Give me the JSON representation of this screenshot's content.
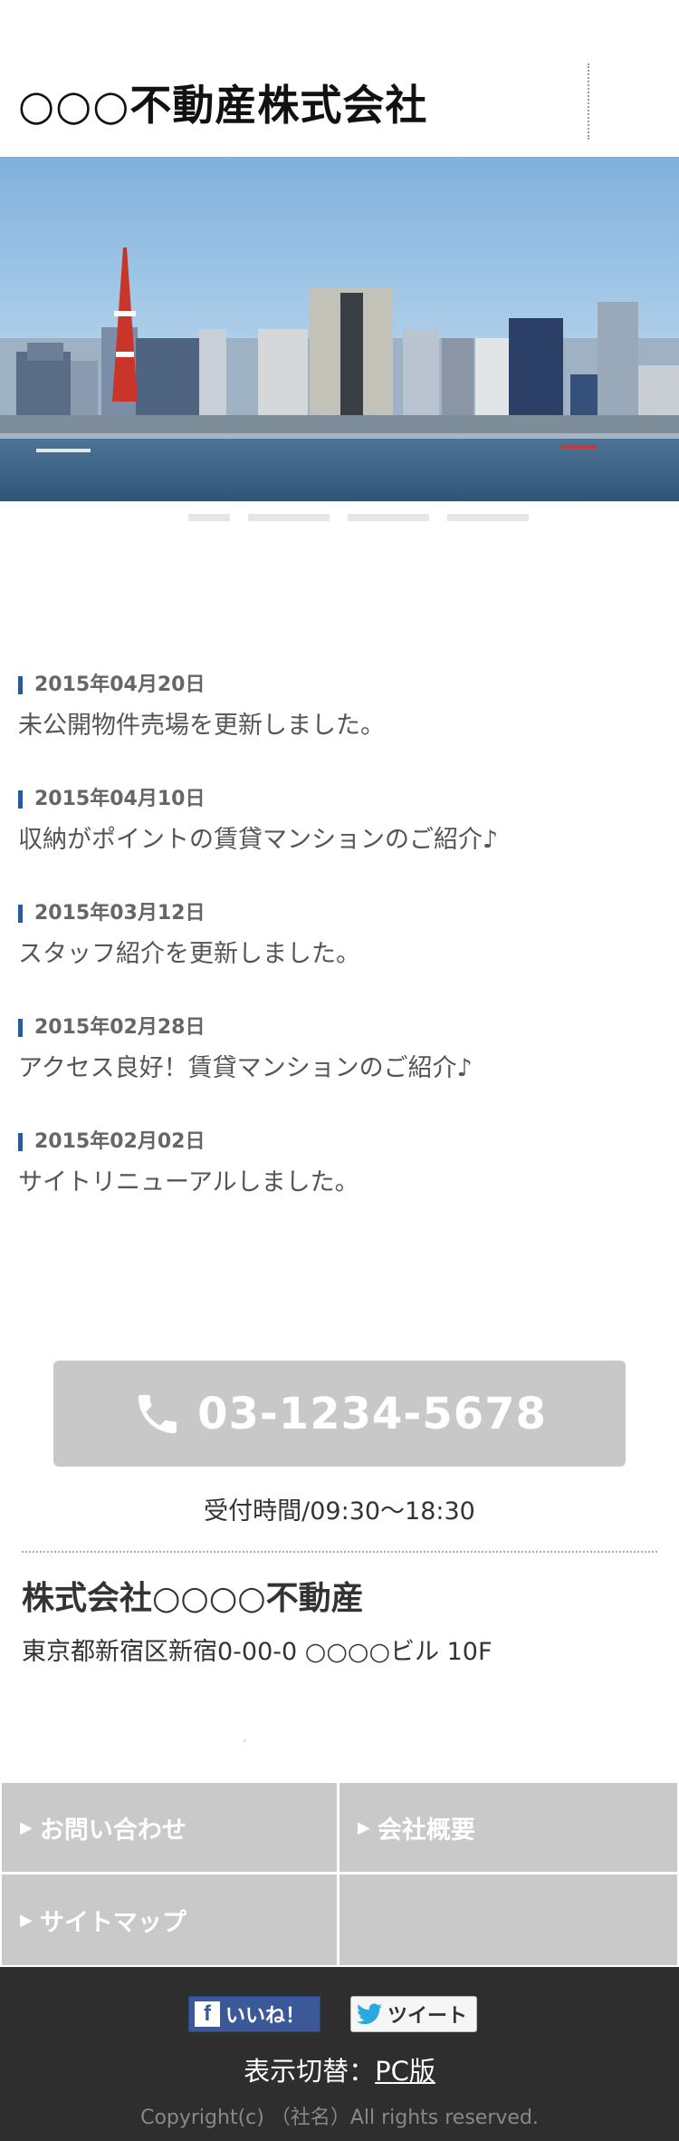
{
  "header": {
    "title": "○○○不動産株式会社"
  },
  "slider": {
    "count": 4
  },
  "news": [
    {
      "date": "2015年04月20日",
      "text": "未公開物件売場を更新しました。"
    },
    {
      "date": "2015年04月10日",
      "text": "収納がポイントの賃貸マンションのご紹介♪"
    },
    {
      "date": "2015年03月12日",
      "text": "スタッフ紹介を更新しました。"
    },
    {
      "date": "2015年02月28日",
      "text": "アクセス良好！賃貸マンションのご紹介♪"
    },
    {
      "date": "2015年02月02日",
      "text": "サイトリニューアルしました。"
    }
  ],
  "contact": {
    "tel": "03-1234-5678",
    "hours": "受付時間/09:30〜18:30",
    "company_name": "株式会社○○○○不動産",
    "address": "東京都新宿区新宿0-00-0 ○○○○ビル 10F",
    "tiny_mark": "`"
  },
  "footer_nav": [
    {
      "label": "お問い合わせ"
    },
    {
      "label": "会社概要"
    },
    {
      "label": "サイトマップ"
    }
  ],
  "social": {
    "like_label": "いいね！",
    "tweet_label": "ツイート"
  },
  "footer": {
    "switch_label": "表示切替：",
    "pc_link": "PC版",
    "copyright": "Copyright(c) （社名）All rights reserved."
  },
  "colors": {
    "accent_bar": "#2b5a9a",
    "tel_button_bg": "#c8c8c8",
    "nav_bg": "#c9c9c9",
    "footer_bg": "#2e2e2e",
    "facebook_blue": "#3b5998"
  },
  "icons": [
    "phone-icon",
    "facebook-icon",
    "twitter-icon",
    "triangle-right-icon"
  ]
}
